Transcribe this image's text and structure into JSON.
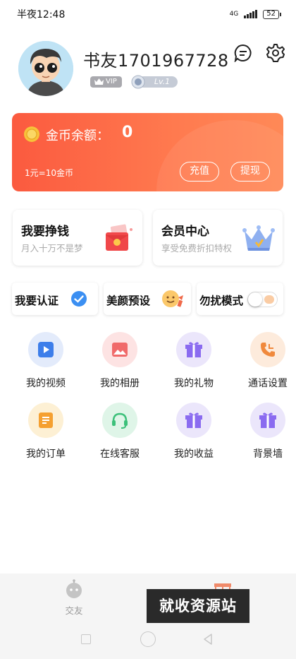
{
  "status_bar": {
    "time": "半夜12:48",
    "network": "4G",
    "battery": "52"
  },
  "profile": {
    "username": "书友1701967728",
    "vip_label": "VIP",
    "level_label": "Lv.1"
  },
  "balance": {
    "label": "金币余额：",
    "value": "0",
    "rate": "1元=10金币",
    "recharge_label": "充值",
    "withdraw_label": "提现"
  },
  "promos": [
    {
      "title": "我要挣钱",
      "subtitle": "月入十万不是梦"
    },
    {
      "title": "会员中心",
      "subtitle": "享受免费折扣特权"
    }
  ],
  "quick_actions": [
    {
      "label": "我要认证"
    },
    {
      "label": "美颜预设"
    },
    {
      "label": "勿扰模式",
      "toggle_on": false
    }
  ],
  "grid": [
    {
      "label": "我的视频",
      "icon": "play-icon",
      "bg": "#e3ebfb",
      "color": "#3d7eea"
    },
    {
      "label": "我的相册",
      "icon": "image-icon",
      "bg": "#fde3e3",
      "color": "#f06a6a"
    },
    {
      "label": "我的礼物",
      "icon": "gift-icon",
      "bg": "#ebe6fb",
      "color": "#8a6bf0"
    },
    {
      "label": "通话设置",
      "icon": "phone-icon",
      "bg": "#fdebdc",
      "color": "#f0893c"
    },
    {
      "label": "我的订单",
      "icon": "order-icon",
      "bg": "#fdf0d4",
      "color": "#f5a030"
    },
    {
      "label": "在线客服",
      "icon": "headset-icon",
      "bg": "#dff5e8",
      "color": "#3cc07a"
    },
    {
      "label": "我的收益",
      "icon": "gift-icon",
      "bg": "#ebe6fb",
      "color": "#8a6bf0"
    },
    {
      "label": "背景墙",
      "icon": "gift-icon",
      "bg": "#ebe6fb",
      "color": "#8a6bf0"
    }
  ],
  "tabbar": {
    "tabs": [
      {
        "label": "交友"
      }
    ]
  },
  "watermark": "就收资源站",
  "colors": {
    "accent": "#fb5a3f",
    "verify": "#3b8ff2"
  }
}
